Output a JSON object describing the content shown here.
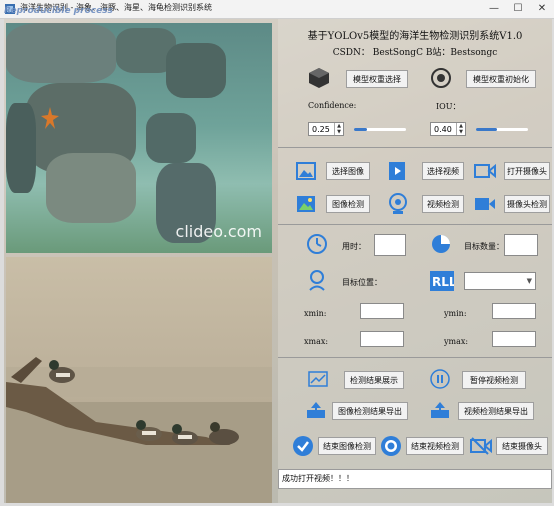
{
  "window": {
    "title": "海洋生物识别 - 海象、海豚、海星、海龟检测识别系统",
    "watermark": "Reproducible process"
  },
  "header": {
    "title": "基于YOLOv5模型的海洋生物检测识别系统V1.0",
    "author": "CSDN：  BestSongC     B站：Bestsongc"
  },
  "model": {
    "select_label": "模型权重选择",
    "init_label": "模型权重初始化"
  },
  "params": {
    "confidence_label": "Confidence:",
    "confidence_value": "0.25",
    "confidence_fraction": 0.25,
    "iou_label": "IOU：",
    "iou_value": "0.40",
    "iou_fraction": 0.4
  },
  "source": {
    "select_image": "选择图像",
    "select_video": "选择视频",
    "open_camera": "打开摄像头",
    "image_detect": "图像检测",
    "video_detect": "视频检测",
    "camera_detect": "摄像头检测"
  },
  "stats": {
    "time_label": "用时：",
    "time_value": "",
    "count_label": "目标数量：",
    "count_value": "",
    "position_label": "目标位置：",
    "position_select": "",
    "xmin_label": "xmin:",
    "ymin_label": "ymin:",
    "xmax_label": "xmax:",
    "ymax_label": "ymax:",
    "xmin": "",
    "ymin": "",
    "xmax": "",
    "ymax": ""
  },
  "actions": {
    "show_result": "检测结果展示",
    "pause_video": "暂停视频检测",
    "export_image": "图像检测结果导出",
    "export_video": "视频检测结果导出",
    "end_image": "结束图像检测",
    "end_video": "结束视频检测",
    "end_camera": "结束摄像头"
  },
  "preview": {
    "watermark_text": "clideo.com"
  },
  "status_text": "成功打开视频！！！",
  "colors": {
    "accent_blue": "#2f7ed8",
    "slider_fill": "#3a78c9"
  }
}
